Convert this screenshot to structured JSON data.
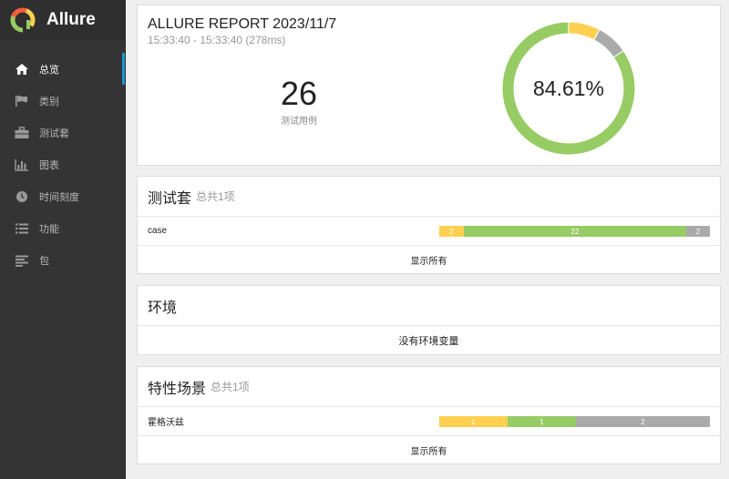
{
  "app": {
    "name": "Allure"
  },
  "sidebar": {
    "items": [
      {
        "label": "总览",
        "icon": "home-icon",
        "active": true
      },
      {
        "label": "类别",
        "icon": "flag-icon"
      },
      {
        "label": "测试套",
        "icon": "briefcase-icon"
      },
      {
        "label": "图表",
        "icon": "bar-chart-icon"
      },
      {
        "label": "时间刻度",
        "icon": "clock-icon"
      },
      {
        "label": "功能",
        "icon": "list-icon"
      },
      {
        "label": "包",
        "icon": "align-left-icon"
      }
    ]
  },
  "summary": {
    "title": "ALLURE REPORT 2023/11/7",
    "time": "15:33:40 - 15:33:40 (278ms)",
    "test_count": "26",
    "test_count_label": "测试用例",
    "pass_rate": "84.61%"
  },
  "colors": {
    "passed": "#97cc64",
    "broken": "#ffd050",
    "unknown": "#aaaaaa",
    "accent": "#1a98d9"
  },
  "chart_data": {
    "type": "pie",
    "categories": [
      "passed",
      "broken",
      "unknown"
    ],
    "values": [
      22,
      2,
      2
    ]
  },
  "suites": {
    "title": "测试套",
    "subtitle": "总共1项",
    "rows": [
      {
        "name": "case",
        "broken": "2",
        "passed": "22",
        "unknown": "2"
      }
    ],
    "show_all": "显示所有"
  },
  "environment": {
    "title": "环境",
    "empty_text": "没有环境变量"
  },
  "features": {
    "title": "特性场景",
    "subtitle": "总共1项",
    "rows": [
      {
        "name": "霍格沃兹",
        "broken": "1",
        "passed": "1",
        "unknown": "2"
      }
    ],
    "show_all": "显示所有"
  }
}
